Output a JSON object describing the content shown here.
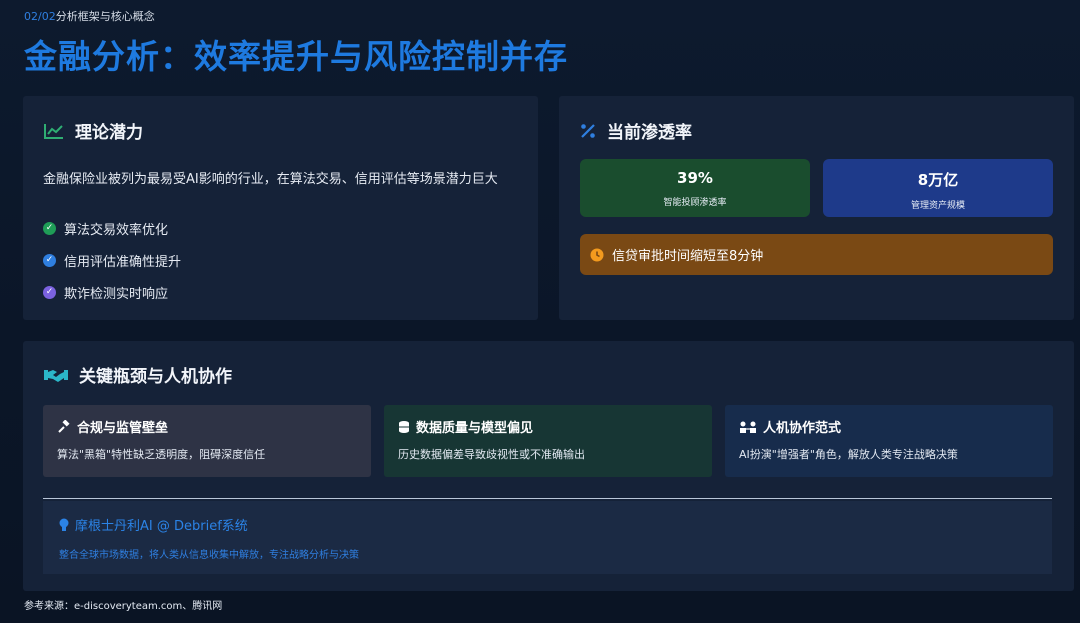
{
  "header": {
    "page_num": "02/02",
    "section": "分析框架与核心概念",
    "title": "金融分析：效率提升与风险控制并存"
  },
  "theory": {
    "icon": "line-chart-icon",
    "title": "理论潜力",
    "description": "金融保险业被列为最易受AI影响的行业，在算法交易、信用评估等场景潜力巨大",
    "bullets": [
      {
        "text": "算法交易效率优化",
        "color": "#1f9d57"
      },
      {
        "text": "信用评估准确性提升",
        "color": "#2f7fe0"
      },
      {
        "text": "欺诈检测实时响应",
        "color": "#7b62e0"
      }
    ]
  },
  "penetration": {
    "icon": "percent-icon",
    "title": "当前渗透率",
    "stats": [
      {
        "value": "39%",
        "label": "智能投顾渗透率",
        "color": "#1a4d2e"
      },
      {
        "value": "8万亿",
        "label": "管理资产规模",
        "color": "#1e3a8a"
      }
    ],
    "alert": {
      "icon": "clock-icon",
      "text": "信贷审批时间缩短至8分钟"
    }
  },
  "bottleneck": {
    "icon": "handshake-icon",
    "title": "关键瓶颈与人机协作",
    "cards": [
      {
        "icon": "gavel-icon",
        "title": "合规与监管壁垒",
        "desc": "算法\"黑箱\"特性缺乏透明度，阻碍深度信任",
        "bg": "#2e3345"
      },
      {
        "icon": "database-icon",
        "title": "数据质量与模型偏见",
        "desc": "历史数据偏差导致歧视性或不准确输出",
        "bg": "#173634"
      },
      {
        "icon": "people-icon",
        "title": "人机协作范式",
        "desc": "AI扮演\"增强者\"角色，解放人类专注战略决策",
        "bg": "#172c4c"
      }
    ],
    "case": {
      "icon": "lightbulb-icon",
      "title": "摩根士丹利AI @ Debrief系统",
      "desc": "整合全球市场数据，将人类从信息收集中解放，专注战略分析与决策"
    }
  },
  "source": "参考来源：e-discoveryteam.com、腾讯网"
}
